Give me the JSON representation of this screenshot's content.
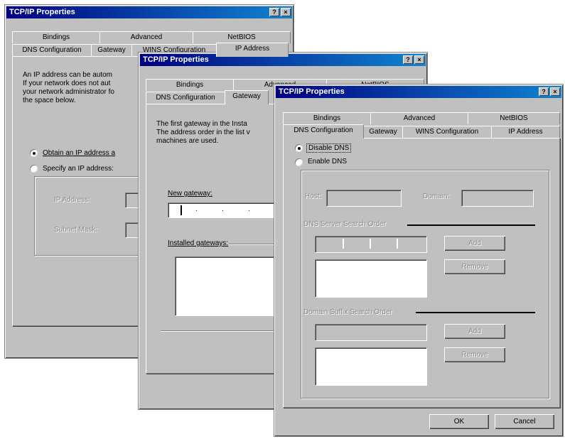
{
  "w1": {
    "title": "TCP/IP Properties",
    "tabs_back": [
      "Bindings",
      "Advanced",
      "NetBIOS"
    ],
    "tabs_front": [
      "DNS Configuration",
      "Gateway",
      "WINS Configuration",
      "IP Address"
    ],
    "description": [
      "An IP address can be autom",
      "If your network does not aut",
      "your network administrator fo",
      "the space below."
    ],
    "obtain_label": "Obtain an IP address a",
    "specify_label": "Specify an IP address:",
    "ip_address_label": "IP Address:",
    "subnet_label": "Subnet Mask:"
  },
  "w2": {
    "title": "TCP/IP Properties",
    "tabs_back": [
      "Bindings",
      "Advanced",
      "NetBIOS"
    ],
    "tabs_front": [
      "DNS Configuration",
      "Gateway"
    ],
    "description": [
      "The first gateway in the Insta",
      "The address order in the list v",
      "machines are used."
    ],
    "new_gateway_label": "New gateway:",
    "installed_gateways_label": "Installed gateways:"
  },
  "w3": {
    "title": "TCP/IP Properties",
    "help_btn": "?",
    "close_btn": "×",
    "tabs_back": [
      "Bindings",
      "Advanced",
      "NetBIOS"
    ],
    "tabs_front": [
      "DNS Configuration",
      "Gateway",
      "WINS Configuration",
      "IP Address"
    ],
    "disable_dns": "Disable DNS",
    "enable_dns": "Enable DNS",
    "host_label": "Host:",
    "domain_label": "Domain:",
    "dns_search_order": "DNS Server Search Order",
    "add1": "Add",
    "remove1": "Remove",
    "domain_suffix": "Domain Suffix Search Order",
    "add2": "Add",
    "remove2": "Remove",
    "ok": "OK",
    "cancel": "Cancel"
  }
}
